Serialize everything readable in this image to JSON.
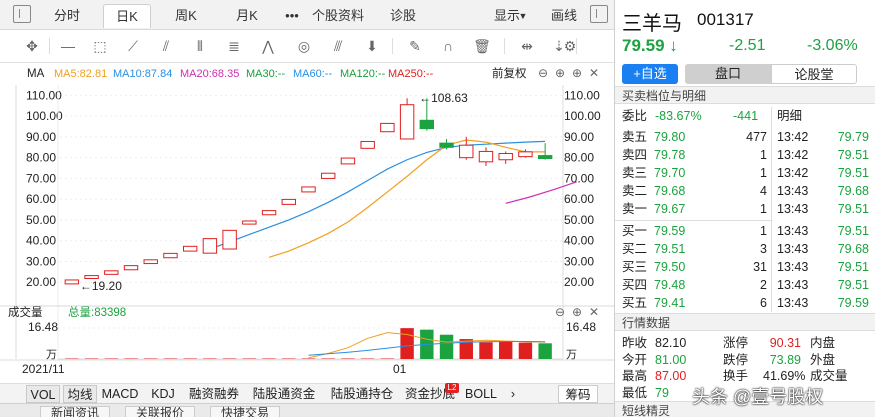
{
  "tabs": {
    "items": [
      "分时",
      "日K",
      "周K",
      "月K",
      "•••",
      "个股资料",
      "诊股"
    ],
    "display": "显示",
    "draw": "画线"
  },
  "indicator": {
    "label": "MA",
    "ma5": "MA5:82.81",
    "ma10": "MA10:87.84",
    "ma20": "MA20:68.35",
    "ma30": "MA30:--",
    "ma60": "MA60:--",
    "ma120": "MA120:--",
    "ma250": "MA250:--",
    "adjust": "前复权"
  },
  "volume": {
    "label": "成交量",
    "total": "总量:83398",
    "top": "16.48",
    "unit": "万"
  },
  "axis": {
    "price_ticks": [
      "110.00",
      "100.00",
      "90.00",
      "80.00",
      "70.00",
      "60.00",
      "50.00",
      "40.00",
      "30.00",
      "20.00"
    ],
    "x_start": "2021/11",
    "x_mid": "01"
  },
  "annotations": {
    "high": "←108.63",
    "low": "←19.20"
  },
  "indicator_tabs": [
    "VOL",
    "均线",
    "MACD",
    "KDJ",
    "融资融券",
    "陆股通资金",
    "陆股通持仓",
    "资金抄底",
    "BOLL"
  ],
  "l2_badge": "L2",
  "chips_label": "筹码",
  "footer_tabs": [
    "新闻资讯",
    "关联报价",
    "快捷交易"
  ],
  "quote": {
    "name": "三羊马",
    "code": "001317",
    "price": "79.59",
    "arrow": "↓",
    "change": "-2.51",
    "pct": "-3.06%",
    "add_watch": "+自选",
    "tab_pankou": "盘口",
    "tab_forum": "论股堂"
  },
  "orderbook": {
    "title": "买卖档位与明细",
    "ratio_label": "委比",
    "ratio": "-83.67%",
    "diff": "-441",
    "detail_label": "明细",
    "asks": [
      {
        "l": "卖五",
        "p": "79.80",
        "v": "477"
      },
      {
        "l": "卖四",
        "p": "79.78",
        "v": "1"
      },
      {
        "l": "卖三",
        "p": "79.70",
        "v": "1"
      },
      {
        "l": "卖二",
        "p": "79.68",
        "v": "4"
      },
      {
        "l": "卖一",
        "p": "79.67",
        "v": "1"
      }
    ],
    "bids": [
      {
        "l": "买一",
        "p": "79.59",
        "v": "1"
      },
      {
        "l": "买二",
        "p": "79.51",
        "v": "3"
      },
      {
        "l": "买三",
        "p": "79.50",
        "v": "31"
      },
      {
        "l": "买四",
        "p": "79.48",
        "v": "2"
      },
      {
        "l": "买五",
        "p": "79.41",
        "v": "6"
      }
    ],
    "details": [
      {
        "t": "13:42",
        "p": "79.79"
      },
      {
        "t": "13:42",
        "p": "79.51"
      },
      {
        "t": "13:42",
        "p": "79.51"
      },
      {
        "t": "13:43",
        "p": "79.68"
      },
      {
        "t": "13:43",
        "p": "79.51"
      },
      {
        "t": "13:43",
        "p": "79.51"
      },
      {
        "t": "13:43",
        "p": "79.68"
      },
      {
        "t": "13:43",
        "p": "79.51"
      },
      {
        "t": "13:43",
        "p": "79.51"
      },
      {
        "t": "13:43",
        "p": "79.59"
      }
    ]
  },
  "stats": {
    "title": "行情数据",
    "rows": [
      {
        "a": "昨收",
        "av": "82.10",
        "b": "涨停",
        "bv": "90.31",
        "c": "内盘"
      },
      {
        "a": "今开",
        "av": "81.00",
        "b": "跌停",
        "bv": "73.89",
        "c": "外盘"
      },
      {
        "a": "最高",
        "av": "87.00",
        "b": "换手",
        "bv": "41.69%",
        "c": "成交量"
      },
      {
        "a": "最低",
        "av": "79",
        "b": "",
        "bv": "",
        "c": ""
      }
    ]
  },
  "section3": "短线精灵",
  "watermark": "头条 @壹号股权",
  "colors": {
    "up": "#e01f1f",
    "down": "#1aa33f",
    "ma5": "#f0a020",
    "ma10": "#2a8fe0",
    "ma20": "#d02fb0",
    "accent": "#1a7ff0"
  },
  "chart_data": {
    "type": "candlestick",
    "xlabel": "",
    "ylabel": "",
    "ylim": [
      10,
      115
    ],
    "x_labels": [
      "2021/11",
      "01"
    ],
    "candles": [
      {
        "o": 19.2,
        "c": 21.1,
        "h": 21.1,
        "l": 19.2
      },
      {
        "o": 21.8,
        "c": 23.2,
        "h": 23.2,
        "l": 21.8
      },
      {
        "o": 23.8,
        "c": 25.5,
        "h": 25.5,
        "l": 23.8
      },
      {
        "o": 26.0,
        "c": 28.0,
        "h": 28.0,
        "l": 26.0
      },
      {
        "o": 29.0,
        "c": 30.8,
        "h": 30.8,
        "l": 29.0
      },
      {
        "o": 31.8,
        "c": 33.9,
        "h": 33.9,
        "l": 31.8
      },
      {
        "o": 35.0,
        "c": 37.3,
        "h": 37.3,
        "l": 35.0
      },
      {
        "o": 34.0,
        "c": 41.0,
        "h": 41.0,
        "l": 34.0
      },
      {
        "o": 36.0,
        "c": 45.0,
        "h": 45.0,
        "l": 36.0
      },
      {
        "o": 48.0,
        "c": 49.5,
        "h": 49.5,
        "l": 48.0
      },
      {
        "o": 52.5,
        "c": 54.5,
        "h": 54.5,
        "l": 52.5
      },
      {
        "o": 57.5,
        "c": 59.9,
        "h": 59.9,
        "l": 57.5
      },
      {
        "o": 63.5,
        "c": 65.9,
        "h": 65.9,
        "l": 63.5
      },
      {
        "o": 70.0,
        "c": 72.5,
        "h": 72.5,
        "l": 70.0
      },
      {
        "o": 77.0,
        "c": 79.8,
        "h": 79.8,
        "l": 77.0
      },
      {
        "o": 84.5,
        "c": 87.8,
        "h": 87.8,
        "l": 84.5
      },
      {
        "o": 92.5,
        "c": 96.5,
        "h": 96.5,
        "l": 92.5
      },
      {
        "o": 89.0,
        "c": 105.5,
        "h": 108.63,
        "l": 89.0
      },
      {
        "o": 98.0,
        "c": 94.0,
        "h": 108.63,
        "l": 93.0
      },
      {
        "o": 87.0,
        "c": 85.0,
        "h": 89.0,
        "l": 84.0
      },
      {
        "o": 80.0,
        "c": 86.0,
        "h": 90.0,
        "l": 79.0
      },
      {
        "o": 78.0,
        "c": 83.0,
        "h": 85.0,
        "l": 76.0
      },
      {
        "o": 79.0,
        "c": 82.0,
        "h": 83.0,
        "l": 77.0
      },
      {
        "o": 80.5,
        "c": 82.8,
        "h": 84.0,
        "l": 80.0
      },
      {
        "o": 81.0,
        "c": 79.59,
        "h": 87.0,
        "l": 79.0
      }
    ],
    "ma5": [
      [
        10,
        32
      ],
      [
        11,
        35
      ],
      [
        12,
        39
      ],
      [
        13,
        43.5
      ],
      [
        14,
        49
      ],
      [
        15,
        56
      ],
      [
        16,
        63.5
      ],
      [
        17,
        71
      ],
      [
        18,
        79
      ],
      [
        19,
        86
      ],
      [
        20,
        88.5
      ],
      [
        21,
        87.5
      ],
      [
        22,
        85
      ],
      [
        23,
        82.8
      ],
      [
        24,
        82.8
      ]
    ],
    "ma10": [
      [
        7,
        36
      ],
      [
        8,
        39.5
      ],
      [
        9,
        43
      ],
      [
        10,
        46.5
      ],
      [
        11,
        50
      ],
      [
        12,
        54
      ],
      [
        13,
        58.5
      ],
      [
        14,
        63.5
      ],
      [
        15,
        69
      ],
      [
        16,
        74.5
      ],
      [
        17,
        79
      ],
      [
        18,
        82.5
      ],
      [
        19,
        85
      ],
      [
        20,
        86
      ],
      [
        21,
        86.5
      ],
      [
        22,
        87
      ],
      [
        23,
        87.5
      ],
      [
        24,
        87.84
      ]
    ],
    "ma20": [
      [
        14,
        58
      ],
      [
        15,
        61
      ],
      [
        16,
        64.5
      ],
      [
        17,
        68.35
      ]
    ],
    "volumes": [
      {
        "v": 0,
        "d": "up"
      },
      {
        "v": 0,
        "d": "up"
      },
      {
        "v": 0,
        "d": "up"
      },
      {
        "v": 0,
        "d": "up"
      },
      {
        "v": 0,
        "d": "up"
      },
      {
        "v": 0,
        "d": "up"
      },
      {
        "v": 0,
        "d": "up"
      },
      {
        "v": 0,
        "d": "up"
      },
      {
        "v": 0,
        "d": "up"
      },
      {
        "v": 0,
        "d": "up"
      },
      {
        "v": 0,
        "d": "up"
      },
      {
        "v": 0,
        "d": "up"
      },
      {
        "v": 0,
        "d": "up"
      },
      {
        "v": 0,
        "d": "up"
      },
      {
        "v": 0,
        "d": "up"
      },
      {
        "v": 0,
        "d": "up"
      },
      {
        "v": 0,
        "d": "up"
      },
      {
        "v": 16.4,
        "d": "up"
      },
      {
        "v": 15.6,
        "d": "down"
      },
      {
        "v": 12.9,
        "d": "down"
      },
      {
        "v": 10.6,
        "d": "up"
      },
      {
        "v": 8.9,
        "d": "up"
      },
      {
        "v": 9.1,
        "d": "up"
      },
      {
        "v": 8.7,
        "d": "up"
      },
      {
        "v": 8.34,
        "d": "down"
      }
    ],
    "volumes_early": [
      0,
      0,
      0,
      0,
      0,
      0,
      0,
      0,
      0,
      0,
      0,
      0,
      0,
      0,
      0,
      0,
      0
    ],
    "vol_ylim": [
      0,
      16.48
    ]
  }
}
